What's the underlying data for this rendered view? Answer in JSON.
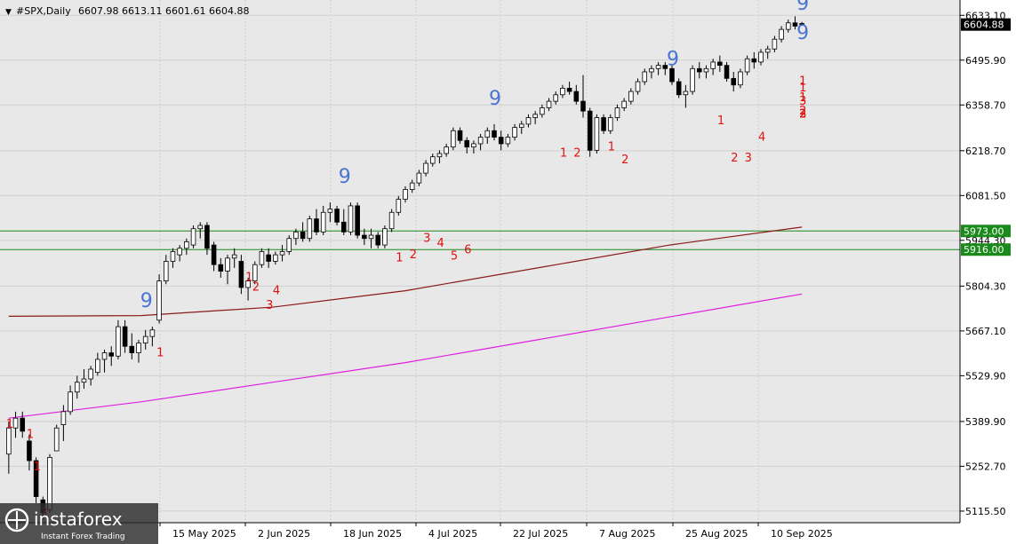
{
  "header": {
    "symbol_label": "#SPX,Daily",
    "ohlc_text": "6607.98 6613.11 6601.61 6604.88"
  },
  "price_axis": {
    "labels": [
      "6633.10",
      "6495.90",
      "6358.70",
      "6218.70",
      "6081.50",
      "5944.30",
      "5804.30",
      "5667.10",
      "5529.90",
      "5389.90",
      "5252.70",
      "5115.50"
    ],
    "current_price_tag": "6604.88",
    "level_tags": [
      "5973.00",
      "5916.00"
    ]
  },
  "time_axis": {
    "labels": [
      "15 May 2025",
      "2 Jun 2025",
      "18 Jun 2025",
      "4 Jul 2025",
      "22 Jul 2025",
      "7 Aug 2025",
      "25 Aug 2025",
      "10 Sep 2025"
    ]
  },
  "watermark": {
    "brand": "instaforex",
    "tagline": "Instant Forex Trading"
  },
  "colors": {
    "background": "#e8e8e8",
    "grid": "#d0d0d0",
    "bull_body": "#ffffff",
    "bear_body": "#000000",
    "wick": "#000000",
    "ma_long": "#8b1a1a",
    "ma_longer": "#e020e0",
    "level_line": "#1a8a1a",
    "seq_nine": "#4a74d4",
    "seq_count": "#7fa3e6",
    "seq_red": "#e01010"
  },
  "chart_data": {
    "type": "candlestick",
    "title": "#SPX,Daily",
    "ylim": [
      5080,
      6680
    ],
    "grid": true,
    "levels": [
      5973.0,
      5916.0
    ],
    "last_price": 6604.88,
    "series": [
      {
        "name": "",
        "type": "candlestick",
        "ohlc": [
          [
            5290,
            5390,
            5230,
            5370
          ],
          [
            5370,
            5420,
            5340,
            5400
          ],
          [
            5400,
            5420,
            5340,
            5360
          ],
          [
            5330,
            5350,
            5240,
            5270
          ],
          [
            5270,
            5280,
            5140,
            5160
          ],
          [
            5150,
            5160,
            5090,
            5110
          ],
          [
            5120,
            5290,
            5110,
            5280
          ],
          [
            5300,
            5380,
            5320,
            5370
          ],
          [
            5380,
            5440,
            5330,
            5420
          ],
          [
            5420,
            5500,
            5410,
            5480
          ],
          [
            5480,
            5530,
            5460,
            5510
          ],
          [
            5510,
            5550,
            5490,
            5520
          ],
          [
            5520,
            5560,
            5500,
            5550
          ],
          [
            5540,
            5600,
            5530,
            5580
          ],
          [
            5580,
            5610,
            5540,
            5600
          ],
          [
            5600,
            5620,
            5560,
            5590
          ],
          [
            5590,
            5700,
            5580,
            5680
          ],
          [
            5680,
            5700,
            5600,
            5620
          ],
          [
            5620,
            5660,
            5580,
            5600
          ],
          [
            5600,
            5640,
            5570,
            5630
          ],
          [
            5630,
            5670,
            5610,
            5650
          ],
          [
            5650,
            5680,
            5620,
            5670
          ],
          [
            5700,
            5840,
            5690,
            5820
          ],
          [
            5820,
            5900,
            5810,
            5880
          ],
          [
            5880,
            5920,
            5860,
            5910
          ],
          [
            5900,
            5930,
            5880,
            5920
          ],
          [
            5920,
            5950,
            5900,
            5940
          ],
          [
            5930,
            5990,
            5920,
            5980
          ],
          [
            5980,
            6000,
            5950,
            5990
          ],
          [
            5990,
            6000,
            5900,
            5920
          ],
          [
            5930,
            5940,
            5850,
            5870
          ],
          [
            5870,
            5890,
            5830,
            5850
          ],
          [
            5850,
            5900,
            5810,
            5890
          ],
          [
            5890,
            5920,
            5860,
            5900
          ],
          [
            5880,
            5900,
            5780,
            5800
          ],
          [
            5800,
            5830,
            5760,
            5820
          ],
          [
            5820,
            5880,
            5810,
            5870
          ],
          [
            5870,
            5920,
            5860,
            5910
          ],
          [
            5900,
            5920,
            5860,
            5880
          ],
          [
            5880,
            5910,
            5870,
            5900
          ],
          [
            5900,
            5930,
            5880,
            5910
          ],
          [
            5910,
            5960,
            5900,
            5950
          ],
          [
            5950,
            5980,
            5930,
            5970
          ],
          [
            5970,
            6000,
            5940,
            5950
          ],
          [
            5950,
            6020,
            5940,
            6010
          ],
          [
            6010,
            6040,
            5960,
            5970
          ],
          [
            5970,
            6050,
            5960,
            6030
          ],
          [
            6030,
            6060,
            6000,
            6040
          ],
          [
            6040,
            6050,
            5990,
            6000
          ],
          [
            6000,
            6040,
            5960,
            5970
          ],
          [
            5970,
            6060,
            5960,
            6050
          ],
          [
            6050,
            6060,
            5950,
            5960
          ],
          [
            5960,
            5980,
            5930,
            5950
          ],
          [
            5950,
            5980,
            5920,
            5960
          ],
          [
            5960,
            5970,
            5920,
            5930
          ],
          [
            5930,
            5990,
            5920,
            5980
          ],
          [
            5980,
            6040,
            5970,
            6030
          ],
          [
            6030,
            6080,
            6020,
            6070
          ],
          [
            6070,
            6110,
            6060,
            6100
          ],
          [
            6100,
            6130,
            6090,
            6120
          ],
          [
            6120,
            6160,
            6110,
            6150
          ],
          [
            6150,
            6190,
            6140,
            6180
          ],
          [
            6180,
            6210,
            6170,
            6200
          ],
          [
            6200,
            6220,
            6180,
            6210
          ],
          [
            6210,
            6240,
            6200,
            6230
          ],
          [
            6230,
            6290,
            6220,
            6280
          ],
          [
            6280,
            6290,
            6240,
            6250
          ],
          [
            6250,
            6260,
            6210,
            6230
          ],
          [
            6230,
            6250,
            6210,
            6240
          ],
          [
            6240,
            6270,
            6220,
            6260
          ],
          [
            6260,
            6290,
            6240,
            6280
          ],
          [
            6280,
            6300,
            6250,
            6260
          ],
          [
            6260,
            6280,
            6220,
            6240
          ],
          [
            6240,
            6270,
            6230,
            6260
          ],
          [
            6260,
            6300,
            6250,
            6290
          ],
          [
            6290,
            6310,
            6270,
            6300
          ],
          [
            6300,
            6330,
            6290,
            6320
          ],
          [
            6320,
            6340,
            6300,
            6330
          ],
          [
            6330,
            6360,
            6320,
            6350
          ],
          [
            6350,
            6380,
            6340,
            6370
          ],
          [
            6370,
            6400,
            6360,
            6390
          ],
          [
            6390,
            6420,
            6380,
            6410
          ],
          [
            6410,
            6430,
            6390,
            6400
          ],
          [
            6400,
            6420,
            6360,
            6370
          ],
          [
            6370,
            6450,
            6320,
            6340
          ],
          [
            6340,
            6350,
            6200,
            6220
          ],
          [
            6220,
            6330,
            6210,
            6320
          ],
          [
            6320,
            6330,
            6270,
            6280
          ],
          [
            6280,
            6330,
            6270,
            6320
          ],
          [
            6320,
            6360,
            6310,
            6350
          ],
          [
            6350,
            6380,
            6340,
            6370
          ],
          [
            6370,
            6410,
            6360,
            6400
          ],
          [
            6400,
            6440,
            6390,
            6430
          ],
          [
            6430,
            6470,
            6420,
            6460
          ],
          [
            6460,
            6480,
            6440,
            6470
          ],
          [
            6470,
            6490,
            6450,
            6480
          ],
          [
            6480,
            6490,
            6450,
            6470
          ],
          [
            6470,
            6480,
            6420,
            6430
          ],
          [
            6430,
            6440,
            6380,
            6390
          ],
          [
            6390,
            6420,
            6350,
            6400
          ],
          [
            6400,
            6480,
            6390,
            6470
          ],
          [
            6470,
            6490,
            6440,
            6460
          ],
          [
            6460,
            6480,
            6440,
            6470
          ],
          [
            6470,
            6500,
            6450,
            6490
          ],
          [
            6490,
            6510,
            6460,
            6480
          ],
          [
            6480,
            6490,
            6430,
            6440
          ],
          [
            6440,
            6460,
            6400,
            6420
          ],
          [
            6420,
            6470,
            6410,
            6460
          ],
          [
            6460,
            6510,
            6450,
            6500
          ],
          [
            6500,
            6520,
            6470,
            6490
          ],
          [
            6490,
            6530,
            6480,
            6520
          ],
          [
            6520,
            6540,
            6500,
            6530
          ],
          [
            6530,
            6570,
            6520,
            6560
          ],
          [
            6560,
            6600,
            6550,
            6590
          ],
          [
            6590,
            6620,
            6580,
            6610
          ],
          [
            6610,
            6630,
            6590,
            6600
          ],
          [
            6607.98,
            6613.11,
            6601.61,
            6604.88
          ]
        ]
      },
      {
        "name": "",
        "type": "line",
        "points": [
          [
            0,
            5712
          ],
          [
            20,
            5714
          ],
          [
            40,
            5740
          ],
          [
            60,
            5790
          ],
          [
            80,
            5860
          ],
          [
            100,
            5930
          ],
          [
            120,
            5985
          ]
        ]
      },
      {
        "name": "",
        "type": "line",
        "points": [
          [
            0,
            5400
          ],
          [
            20,
            5450
          ],
          [
            40,
            5510
          ],
          [
            60,
            5570
          ],
          [
            80,
            5640
          ],
          [
            100,
            5710
          ],
          [
            120,
            5780
          ]
        ]
      }
    ],
    "sequential_labels": [
      {
        "text": "9",
        "index": 20,
        "price": 5740,
        "style": "nine"
      },
      {
        "text": "9",
        "index": 49,
        "price": 6120,
        "style": "nine"
      },
      {
        "text": "9",
        "index": 71,
        "price": 6360,
        "style": "nine"
      },
      {
        "text": "9",
        "index": 97,
        "price": 6480,
        "style": "nine"
      },
      {
        "text": "9",
        "index": 121,
        "price": 6560,
        "style": "nine"
      },
      {
        "text": "9",
        "index": 149,
        "price": 6650,
        "style": "nine"
      },
      {
        "text": "1",
        "index": 22,
        "price": 5590,
        "style": "red"
      },
      {
        "text": "1",
        "index": 35,
        "price": 5820,
        "style": "red"
      },
      {
        "text": "2",
        "index": 36,
        "price": 5790,
        "style": "red"
      },
      {
        "text": "4",
        "index": 39,
        "price": 5780,
        "style": "red"
      },
      {
        "text": "3",
        "index": 38,
        "price": 5735,
        "style": "red"
      },
      {
        "text": "1",
        "index": 57,
        "price": 5880,
        "style": "red"
      },
      {
        "text": "2",
        "index": 59,
        "price": 5890,
        "style": "red"
      },
      {
        "text": "3",
        "index": 61,
        "price": 5940,
        "style": "red"
      },
      {
        "text": "4",
        "index": 63,
        "price": 5925,
        "style": "red"
      },
      {
        "text": "5",
        "index": 65,
        "price": 5885,
        "style": "red"
      },
      {
        "text": "6",
        "index": 67,
        "price": 5905,
        "style": "red"
      },
      {
        "text": "1",
        "index": 81,
        "price": 6200,
        "style": "red"
      },
      {
        "text": "2",
        "index": 83,
        "price": 6200,
        "style": "red"
      },
      {
        "text": "1",
        "index": 88,
        "price": 6220,
        "style": "red"
      },
      {
        "text": "2",
        "index": 90,
        "price": 6180,
        "style": "red"
      },
      {
        "text": "1",
        "index": 104,
        "price": 6300,
        "style": "red"
      },
      {
        "text": "2",
        "index": 106,
        "price": 6185,
        "style": "red"
      },
      {
        "text": "3",
        "index": 108,
        "price": 6185,
        "style": "red"
      },
      {
        "text": "4",
        "index": 110,
        "price": 6250,
        "style": "red"
      },
      {
        "text": "1",
        "index": 121,
        "price": 6370,
        "style": "red"
      },
      {
        "text": "2",
        "index": 123,
        "price": 6320,
        "style": "red"
      },
      {
        "text": "3",
        "index": 124,
        "price": 6320,
        "style": "red"
      },
      {
        "text": "1",
        "index": 133,
        "price": 6400,
        "style": "red"
      },
      {
        "text": "2",
        "index": 134,
        "price": 6320,
        "style": "red"
      },
      {
        "text": "1",
        "index": 136,
        "price": 6420,
        "style": "red"
      },
      {
        "text": "2",
        "index": 137,
        "price": 6330,
        "style": "red"
      },
      {
        "text": "3",
        "index": 138,
        "price": 6360,
        "style": "red"
      },
      {
        "text": "1",
        "index": 0,
        "price": 5370,
        "style": "red"
      },
      {
        "text": "1",
        "index": 3,
        "price": 5340,
        "style": "red"
      },
      {
        "text": "1",
        "index": 4,
        "price": 5240,
        "style": "red"
      },
      {
        "text": "3",
        "index": 5,
        "price": 5100,
        "style": "red"
      }
    ]
  }
}
